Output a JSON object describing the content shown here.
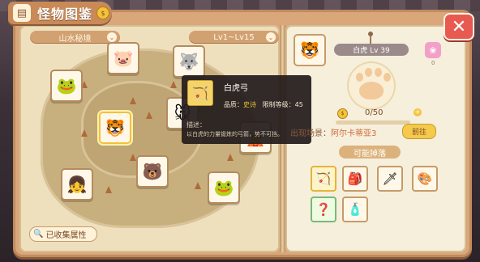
{
  "header": {
    "title": "怪物图鉴",
    "title_icon": "book-icon",
    "coin_glyph": "$",
    "close_label": "✕"
  },
  "filters": {
    "region": "山水秘境",
    "level_range": "Lv1~Lv15",
    "arrow": "⌄"
  },
  "map": {
    "monsters": [
      {
        "id": "pig",
        "glyph": "🐷"
      },
      {
        "id": "frog",
        "glyph": "🐸"
      },
      {
        "id": "wolf",
        "glyph": "🐺"
      },
      {
        "id": "tiger",
        "glyph": "🐯"
      },
      {
        "id": "rat",
        "glyph": "🐭"
      },
      {
        "id": "elf",
        "glyph": "🧝"
      },
      {
        "id": "girl",
        "glyph": "👧"
      },
      {
        "id": "bear",
        "glyph": "🐻"
      },
      {
        "id": "toad",
        "glyph": "🐸"
      }
    ],
    "collect_label": "已收集属性"
  },
  "tooltip": {
    "item_glyph": "🏹",
    "name": "白虎弓",
    "quality_label": "品质：",
    "quality_value": "史诗",
    "level_label": "限制等级：45",
    "desc_label": "描述：",
    "desc_text": "以白虎的力量锻炼的弓箭，势不可挡。"
  },
  "detail": {
    "avatar_glyph": "🐯",
    "name_level": "白虎 Lv 39",
    "book_glyph": "❀",
    "book_count": "0",
    "progress_text": "0/50",
    "progress_current": 0,
    "progress_max": 50,
    "plus": "+",
    "appear_label": "出现场景：",
    "appear_place": "阿尔卡蒂亚3",
    "goto_label": "前往",
    "drops_title": "可能掉落",
    "drops": [
      {
        "glyph": "🏹",
        "tier": "gold"
      },
      {
        "glyph": "🎒",
        "tier": ""
      },
      {
        "glyph": "🗡",
        "tier": ""
      },
      {
        "glyph": "🎨",
        "tier": ""
      },
      {
        "glyph": "❓",
        "tier": "green"
      },
      {
        "glyph": "🧴",
        "tier": ""
      }
    ]
  }
}
